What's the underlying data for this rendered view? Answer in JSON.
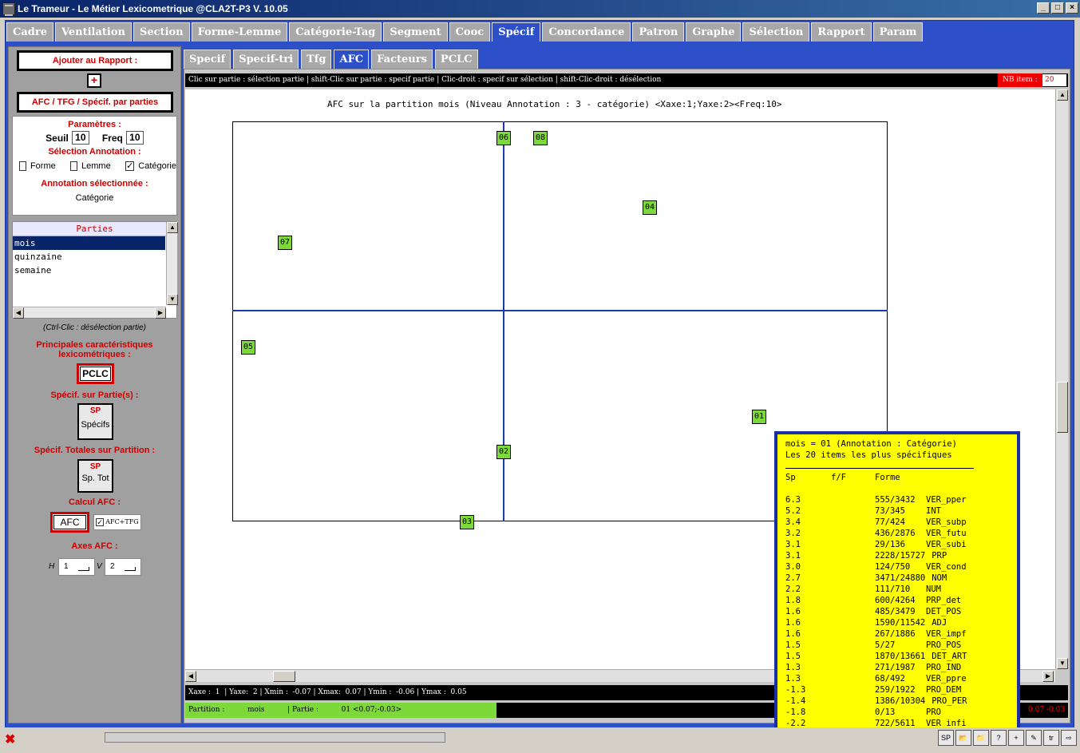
{
  "window": {
    "title": "Le Trameur - Le Métier Lexicometrique @CLA2T-P3 V. 10.05",
    "min": "_",
    "max": "□",
    "close": "×"
  },
  "main_tabs": [
    {
      "label": "Cadre",
      "active": false
    },
    {
      "label": "Ventilation",
      "active": false
    },
    {
      "label": "Section",
      "active": false
    },
    {
      "label": "Forme-Lemme",
      "active": false
    },
    {
      "label": "Catégorie-Tag",
      "active": false
    },
    {
      "label": "Segment",
      "active": false
    },
    {
      "label": "Cooc",
      "active": false
    },
    {
      "label": "Spécif",
      "active": true
    },
    {
      "label": "Concordance",
      "active": false
    },
    {
      "label": "Patron",
      "active": false
    },
    {
      "label": "Graphe",
      "active": false
    },
    {
      "label": "Sélection",
      "active": false
    },
    {
      "label": "Rapport",
      "active": false
    },
    {
      "label": "Param",
      "active": false
    }
  ],
  "sub_tabs": [
    {
      "label": "Specif",
      "active": false
    },
    {
      "label": "Specif-tri",
      "active": false
    },
    {
      "label": "Tfg",
      "active": false
    },
    {
      "label": "AFC",
      "active": true
    },
    {
      "label": "Facteurs",
      "active": false
    },
    {
      "label": "PCLC",
      "active": false
    }
  ],
  "left": {
    "add_report": "Ajouter au Rapport :",
    "plus": "+",
    "mode": "AFC / TFG / Spécif. par parties",
    "params_title": "Paramètres :",
    "seuil_label": "Seuil",
    "seuil_value": "10",
    "freq_label": "Freq",
    "freq_value": "10",
    "sel_annot_title": "Sélection Annotation :",
    "cb_forme": "Forme",
    "cb_lemme": "Lemme",
    "cb_categorie": "Catégorie",
    "cb_check": "✓",
    "annot_selected_title": "Annotation sélectionnée :",
    "annot_selected": "Catégorie",
    "parties_header": "Parties",
    "parties": [
      "mois",
      "quinzaine",
      "semaine"
    ],
    "ctrl_hint": "(Ctrl-Clic : désélection partie)",
    "principales": "Principales caractéristiques lexicométriques :",
    "pclc_btn": "PCLC",
    "specif_parties": "Spécif. sur Partie(s) :",
    "specifs_btn_sp": "SP",
    "specifs_btn": "Spécifs",
    "specif_totales": "Spécif. Totales sur Partition :",
    "sptot_btn_sp": "SP",
    "sptot_btn": "Sp. Tot",
    "calcul_afc": "Calcul AFC :",
    "afc_btn": "AFC",
    "afc_tfg": "AFC+TFG",
    "axes_afc": "Axes AFC :",
    "h_label": "H",
    "h_value": "1",
    "v_label": "V",
    "v_value": "2"
  },
  "infobar": {
    "text": "Clic sur partie : sélection partie | shift-Clic sur partie : specif partie | Clic-droit : specif sur sélection | shift-Clic-droit : désélection",
    "nb_item_label": "NB item :",
    "nb_item_value": "20"
  },
  "plot": {
    "title": "AFC sur la partition mois (Niveau Annotation : 3 - catégorie) <Xaxe:1;Yaxe:2><Freq:10>",
    "points": [
      {
        "label": "06"
      },
      {
        "label": "08"
      },
      {
        "label": "04"
      },
      {
        "label": "07"
      },
      {
        "label": "05"
      },
      {
        "label": "01"
      },
      {
        "label": "02"
      },
      {
        "label": "03"
      }
    ]
  },
  "axesbar": "Xaxe :  1  | Yaxe:  2 | Xmin :  -0.07 | Xmax:  0.07 | Ymin :  -0.06 | Ymax :  0.05",
  "partbar": {
    "text": "Partition :          mois          | Partie :          01 <0.07;-0.03>",
    "coord": "0.07 -0.03"
  },
  "tooltip": {
    "line1": "mois = 01 (Annotation : Catégorie)",
    "line2": "Les 20 items les plus spécifiques",
    "h_sp": "Sp",
    "h_ff": "f/F",
    "h_forme": "Forme",
    "rows": [
      {
        "sp": "6.3",
        "ff": "555/3432",
        "forme": "VER_pper"
      },
      {
        "sp": "5.2",
        "ff": "73/345",
        "forme": "INT"
      },
      {
        "sp": "3.4",
        "ff": "77/424",
        "forme": "VER_subp"
      },
      {
        "sp": "3.2",
        "ff": "436/2876",
        "forme": "VER_futu"
      },
      {
        "sp": "3.1",
        "ff": "29/136",
        "forme": "VER_subi"
      },
      {
        "sp": "3.1",
        "ff": "2228/15727",
        "forme": "PRP"
      },
      {
        "sp": "3.0",
        "ff": "124/750",
        "forme": "VER_cond"
      },
      {
        "sp": "2.7",
        "ff": "3471/24880",
        "forme": "NOM"
      },
      {
        "sp": "2.2",
        "ff": "111/710",
        "forme": "NUM"
      },
      {
        "sp": "1.8",
        "ff": "600/4264",
        "forme": "PRP_det"
      },
      {
        "sp": "1.6",
        "ff": "485/3479",
        "forme": "DET_POS"
      },
      {
        "sp": "1.6",
        "ff": "1590/11542",
        "forme": "ADJ"
      },
      {
        "sp": "1.6",
        "ff": "267/1886",
        "forme": "VER_impf"
      },
      {
        "sp": "1.5",
        "ff": "5/27",
        "forme": "PRO_POS"
      },
      {
        "sp": "1.5",
        "ff": "1870/13661",
        "forme": "DET_ART"
      },
      {
        "sp": "1.3",
        "ff": "271/1987",
        "forme": "PRO_IND"
      },
      {
        "sp": "1.3",
        "ff": "68/492",
        "forme": "VER_ppre"
      },
      {
        "sp": "-1.3",
        "ff": "259/1922",
        "forme": "PRO_DEM"
      },
      {
        "sp": "-1.4",
        "ff": "1386/10304",
        "forme": "PRO_PER"
      },
      {
        "sp": "-1.8",
        "ff": "0/13",
        "forme": "PRO"
      },
      {
        "sp": "-2.2",
        "ff": "722/5611",
        "forme": "VER_infi"
      }
    ]
  },
  "status": {
    "close_glyph": "✖",
    "icons": [
      "SP",
      "📂",
      "📁",
      "?",
      "+",
      "✎",
      "tr",
      "⇨"
    ]
  }
}
